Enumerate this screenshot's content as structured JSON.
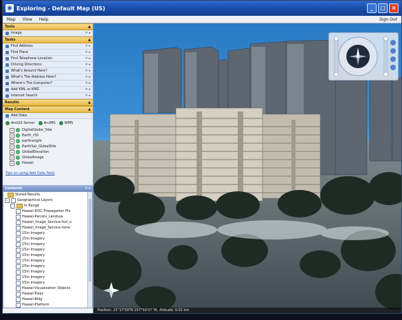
{
  "window": {
    "title": "Exploring - Default Map (US)",
    "sign_out": "Sign Out"
  },
  "menu": [
    "Map",
    "View",
    "Help"
  ],
  "tools": {
    "header": "Tools",
    "items": [
      "Image"
    ]
  },
  "tasks": {
    "header": "Tasks",
    "items": [
      "Find Address",
      "Find Place",
      "Find Telephone Location",
      "Driving Directions",
      "What's Around Here?",
      "What's The Address Here?",
      "Where's The Computer?",
      "Add KML or KMZ",
      "Internet Search"
    ]
  },
  "results": {
    "header": "Results"
  },
  "map_content": {
    "header": "Map Content",
    "add_data": "Add Data",
    "servers": [
      "ArcGIS Server",
      "ArcIMS",
      "WMS"
    ],
    "layers": [
      "DigitalGlobe_3dw",
      "Earth_r50",
      "earthsnight",
      "EarthSat_GlobalSite",
      "GlobalElevation",
      "GlobalImage",
      "Hawaii"
    ],
    "tip": "Tips on using Add Data Tools"
  },
  "contents": {
    "header": "Contents",
    "stored_results": "Stored Results",
    "geographical_layers": "Geographical Layers",
    "in_range": "In Range",
    "layers": [
      "Hawaii-DOC Propagation Plo",
      "Hawaii-Parcels_Landuse",
      "Hawaii_Image_Service-fort_o",
      "Hawaii_Image_Service-hono",
      "15in Imagery",
      "15in Imagery",
      "15in Imagery",
      "15in Imagery",
      "15in Imagery",
      "15in Imagery",
      "15in Imagery",
      "15in Imagery",
      "15in Imagery",
      "15in Imagery",
      "Hawaii-Visualization Objects",
      "Hawaii-Trees",
      "Hawaii-Bldg",
      "Hawaii-Platform"
    ]
  },
  "status_bar": {
    "text": "Position: 21°17'03\"N 157°50'07\"W, Altitude: 0.01 km"
  },
  "colors": {
    "task_header": "#e8b946",
    "sky": "#2f7fc6",
    "title_bar": "#1b4fae"
  }
}
